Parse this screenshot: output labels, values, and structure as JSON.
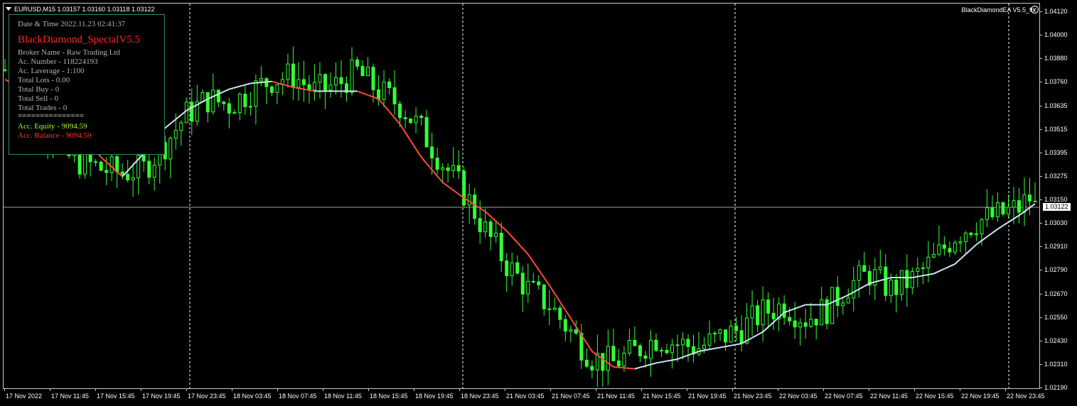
{
  "header": {
    "symbol_line": "EURUSD,M15  1.03157 1.03160 1.03118 1.03122",
    "ea_name": "BlackDiamondEA  V5.5_fix",
    "ea_icon": "smiley-icon"
  },
  "info_panel": {
    "date_time": "Date & Time 2022.11.23 02:41:37",
    "title": "BlackDiamond_SpecialV5.5",
    "broker": "Broker Name - Raw Trading Ltd",
    "account_number": "Ac. Number - 118224193",
    "leverage": "Ac. Laverage - 1:100",
    "total_lots": "Total Lots - 0.00",
    "total_buy": "Total Buy - 0",
    "total_sell": "Total Sell - 0",
    "total_trades": "Total Trades - 0",
    "divider": "===============",
    "equity": "Acc. Equity - 9094.59",
    "balance": "Acc. Balance - 9094.59"
  },
  "price_axis": {
    "labels": [
      "1.04120",
      "1.04000",
      "1.03880",
      "1.03760",
      "1.03635",
      "1.03515",
      "1.03395",
      "1.03275",
      "1.03150",
      "1.03030",
      "1.02910",
      "1.02790",
      "1.02670",
      "1.02550",
      "1.02430",
      "1.02310",
      "1.02190"
    ],
    "current_price": "1.03122"
  },
  "time_axis": {
    "labels": [
      "17 Nov 2022",
      "17 Nov 11:45",
      "17 Nov 15:45",
      "17 Nov 19:45",
      "17 Nov 23:45",
      "18 Nov 03:45",
      "18 Nov 07:45",
      "18 Nov 11:45",
      "18 Nov 15:45",
      "18 Nov 19:45",
      "18 Nov 23:45",
      "21 Nov 03:45",
      "21 Nov 07:45",
      "21 Nov 11:45",
      "21 Nov 15:45",
      "21 Nov 19:45",
      "21 Nov 23:45",
      "22 Nov 03:45",
      "22 Nov 07:45",
      "22 Nov 11:45",
      "22 Nov 15:45",
      "22 Nov 19:45",
      "22 Nov 23:45"
    ]
  },
  "colors": {
    "candles": "#33ff33",
    "ma_up": "#c8e6f5",
    "ma_down": "#ff4a3a",
    "grid_separator": "#ffffff",
    "price_line": "#a0a0a0"
  },
  "chart_data": {
    "type": "candlestick",
    "price_range": [
      1.0219,
      1.0412
    ],
    "close_path": [
      [
        0,
        1.0383
      ],
      [
        3,
        1.037
      ],
      [
        6,
        1.0362
      ],
      [
        9,
        1.0348
      ],
      [
        12,
        1.0338
      ],
      [
        15,
        1.0335
      ],
      [
        18,
        1.0332
      ],
      [
        22,
        1.033
      ],
      [
        26,
        1.0332
      ],
      [
        30,
        1.0345
      ],
      [
        34,
        1.036
      ],
      [
        38,
        1.0368
      ],
      [
        42,
        1.0365
      ],
      [
        46,
        1.0372
      ],
      [
        50,
        1.0378
      ],
      [
        54,
        1.038
      ],
      [
        58,
        1.0372
      ],
      [
        62,
        1.0375
      ],
      [
        66,
        1.0382
      ],
      [
        70,
        1.0372
      ],
      [
        74,
        1.0365
      ],
      [
        78,
        1.0352
      ],
      [
        82,
        1.0335
      ],
      [
        86,
        1.032
      ],
      [
        90,
        1.03
      ],
      [
        94,
        1.0283
      ],
      [
        98,
        1.027
      ],
      [
        102,
        1.0262
      ],
      [
        106,
        1.0248
      ],
      [
        110,
        1.0235
      ],
      [
        114,
        1.0232
      ],
      [
        118,
        1.0238
      ],
      [
        122,
        1.0245
      ],
      [
        126,
        1.0242
      ],
      [
        130,
        1.024
      ],
      [
        134,
        1.0245
      ],
      [
        138,
        1.025
      ],
      [
        142,
        1.0258
      ],
      [
        146,
        1.0262
      ],
      [
        150,
        1.0255
      ],
      [
        154,
        1.026
      ],
      [
        158,
        1.0272
      ],
      [
        162,
        1.0278
      ],
      [
        166,
        1.027
      ],
      [
        170,
        1.0275
      ],
      [
        174,
        1.0285
      ],
      [
        178,
        1.0298
      ],
      [
        182,
        1.0305
      ],
      [
        186,
        1.0308
      ],
      [
        190,
        1.0312
      ],
      [
        192,
        1.0317
      ],
      [
        193,
        1.0312
      ]
    ],
    "ma_path": [
      [
        0,
        1.0378
      ],
      [
        6,
        1.037
      ],
      [
        12,
        1.0358
      ],
      [
        18,
        1.0338
      ],
      [
        22,
        1.0328
      ],
      [
        26,
        1.034
      ],
      [
        30,
        1.0353
      ],
      [
        34,
        1.0362
      ],
      [
        38,
        1.0368
      ],
      [
        42,
        1.0373
      ],
      [
        46,
        1.0376
      ],
      [
        50,
        1.0377
      ],
      [
        54,
        1.0374
      ],
      [
        58,
        1.0372
      ],
      [
        62,
        1.0372
      ],
      [
        66,
        1.0372
      ],
      [
        70,
        1.0368
      ],
      [
        74,
        1.0355
      ],
      [
        78,
        1.0338
      ],
      [
        82,
        1.0325
      ],
      [
        86,
        1.0317
      ],
      [
        90,
        1.031
      ],
      [
        94,
        1.03
      ],
      [
        98,
        1.0288
      ],
      [
        102,
        1.0272
      ],
      [
        106,
        1.0255
      ],
      [
        110,
        1.0238
      ],
      [
        114,
        1.023
      ],
      [
        118,
        1.0229
      ],
      [
        122,
        1.0232
      ],
      [
        126,
        1.0234
      ],
      [
        130,
        1.0238
      ],
      [
        134,
        1.024
      ],
      [
        138,
        1.0242
      ],
      [
        142,
        1.0248
      ],
      [
        146,
        1.0258
      ],
      [
        150,
        1.0262
      ],
      [
        154,
        1.0262
      ],
      [
        158,
        1.0267
      ],
      [
        162,
        1.0273
      ],
      [
        166,
        1.0276
      ],
      [
        170,
        1.0276
      ],
      [
        174,
        1.0278
      ],
      [
        178,
        1.0283
      ],
      [
        182,
        1.0293
      ],
      [
        186,
        1.0301
      ],
      [
        190,
        1.0308
      ],
      [
        193,
        1.0314
      ]
    ]
  }
}
